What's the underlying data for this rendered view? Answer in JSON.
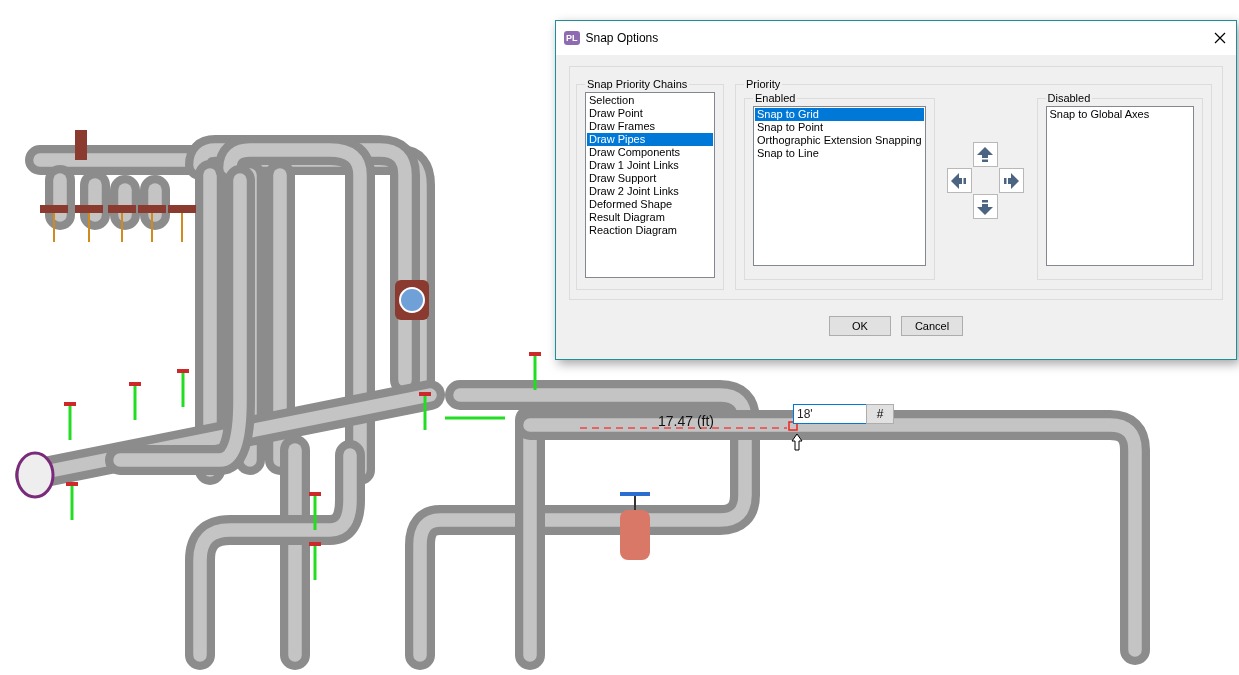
{
  "viewport": {
    "dimension": "17.47 (ft)",
    "length_field": {
      "value": "18'"
    },
    "units_button": "#"
  },
  "dialog": {
    "badge": "PL",
    "title": "Snap Options",
    "chains": {
      "label": "Snap Priority Chains",
      "items": [
        {
          "label": "Selection",
          "selected": false
        },
        {
          "label": "Draw Point",
          "selected": false
        },
        {
          "label": "Draw Frames",
          "selected": false
        },
        {
          "label": "Draw Pipes",
          "selected": true
        },
        {
          "label": "Draw Components",
          "selected": false
        },
        {
          "label": "Draw 1 Joint Links",
          "selected": false
        },
        {
          "label": "Draw Support",
          "selected": false
        },
        {
          "label": "Draw 2 Joint Links",
          "selected": false
        },
        {
          "label": "Deformed Shape",
          "selected": false
        },
        {
          "label": "Result Diagram",
          "selected": false
        },
        {
          "label": "Reaction Diagram",
          "selected": false
        }
      ]
    },
    "priority": {
      "label": "Priority",
      "enabled": {
        "label": "Enabled",
        "items": [
          {
            "label": "Snap to Grid",
            "selected": true
          },
          {
            "label": "Snap to Point",
            "selected": false
          },
          {
            "label": "Orthographic Extension Snapping",
            "selected": false
          },
          {
            "label": "Snap to Line",
            "selected": false
          }
        ]
      },
      "disabled": {
        "label": "Disabled",
        "items": [
          {
            "label": "Snap to Global Axes",
            "selected": false
          }
        ]
      }
    },
    "buttons": [
      {
        "label": "OK"
      },
      {
        "label": "Cancel"
      }
    ]
  }
}
